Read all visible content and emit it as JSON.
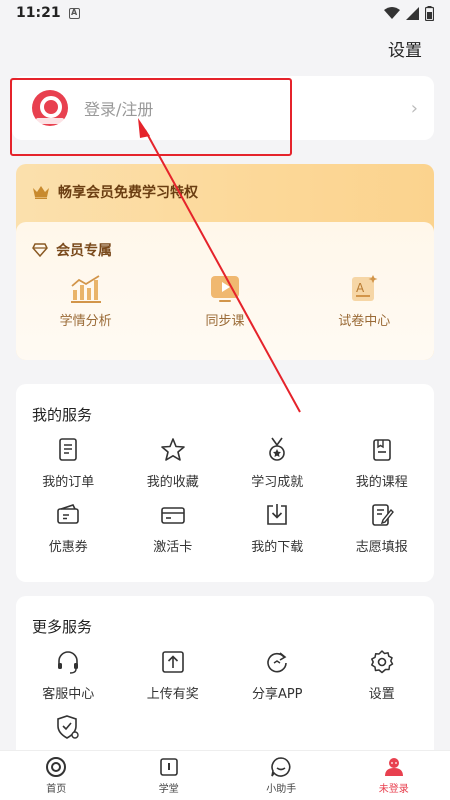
{
  "status_bar": {
    "time": "11:21",
    "a_badge": "A"
  },
  "header": {
    "settings_label": "设置"
  },
  "login": {
    "label": "登录/注册"
  },
  "vip": {
    "banner_text": "畅享会员免费学习特权",
    "section_title": "会员专属",
    "items": [
      {
        "label": "学情分析",
        "icon": "bar-chart-icon"
      },
      {
        "label": "同步课",
        "icon": "video-play-icon"
      },
      {
        "label": "试卷中心",
        "icon": "exam-paper-icon"
      }
    ]
  },
  "my_services": {
    "title": "我的服务",
    "items": [
      {
        "label": "我的订单",
        "icon": "order-icon"
      },
      {
        "label": "我的收藏",
        "icon": "star-icon"
      },
      {
        "label": "学习成就",
        "icon": "medal-icon"
      },
      {
        "label": "我的课程",
        "icon": "course-book-icon"
      },
      {
        "label": "优惠券",
        "icon": "coupon-icon"
      },
      {
        "label": "激活卡",
        "icon": "card-icon"
      },
      {
        "label": "我的下载",
        "icon": "download-icon"
      },
      {
        "label": "志愿填报",
        "icon": "form-edit-icon"
      }
    ]
  },
  "more_services": {
    "title": "更多服务",
    "items": [
      {
        "label": "客服中心",
        "icon": "headset-icon"
      },
      {
        "label": "上传有奖",
        "icon": "upload-icon"
      },
      {
        "label": "分享APP",
        "icon": "share-icon"
      },
      {
        "label": "设置",
        "icon": "gear-icon"
      }
    ]
  },
  "bottom_nav": [
    {
      "label": "首页",
      "icon": "home-logo-icon"
    },
    {
      "label": "学堂",
      "icon": "school-book-icon"
    },
    {
      "label": "小助手",
      "icon": "assistant-chat-icon"
    },
    {
      "label": "未登录",
      "icon": "user-avatar-icon",
      "active": true
    }
  ],
  "colors": {
    "accent": "#e8404f",
    "highlight": "#e5232b",
    "gold": "#fbd38e"
  }
}
